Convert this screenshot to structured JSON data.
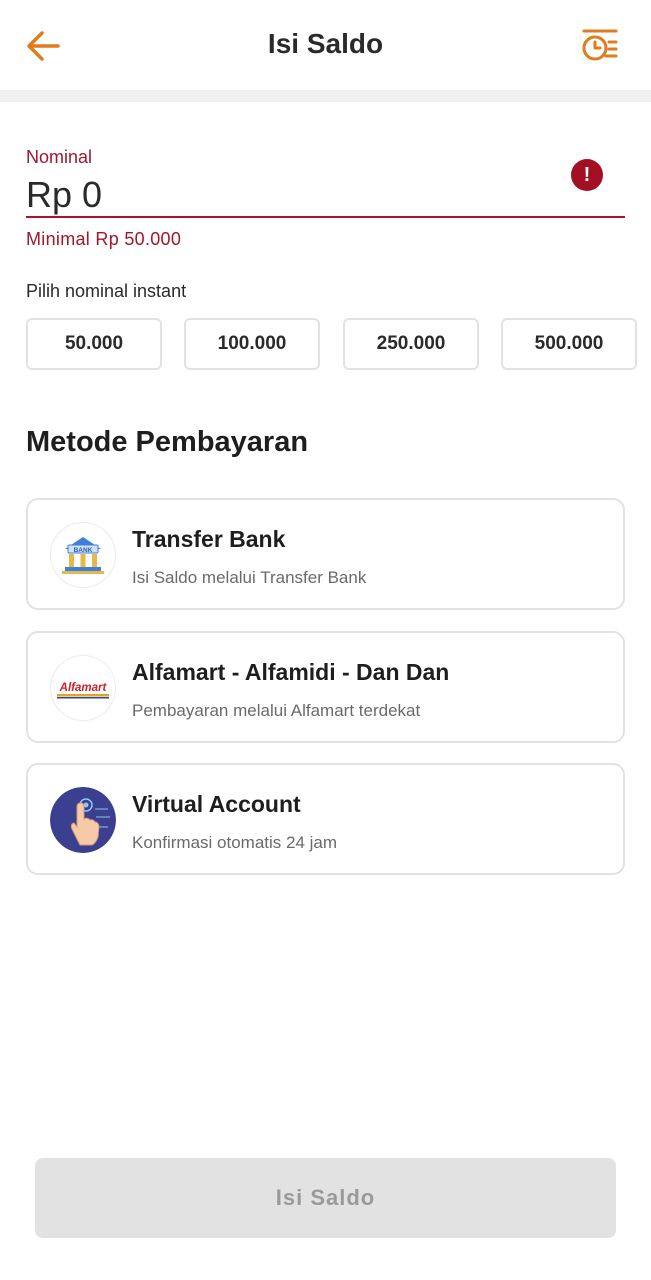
{
  "header": {
    "title": "Isi Saldo",
    "back_icon": "arrow-left-icon",
    "history_icon": "clock-list-icon",
    "accent_color": "#E07B1E"
  },
  "nominal": {
    "label": "Nominal",
    "value": "Rp 0",
    "error": "Minimal Rp 50.000",
    "error_color": "#A3162B",
    "error_icon": "exclamation-icon"
  },
  "instant": {
    "label": "Pilih nominal instant",
    "options": [
      "50.000",
      "100.000",
      "250.000",
      "500.000"
    ]
  },
  "payment": {
    "title": "Metode Pembayaran",
    "methods": [
      {
        "title": "Transfer Bank",
        "description": "Isi Saldo melalui Transfer Bank",
        "icon": "bank-icon",
        "icon_text": "BANK"
      },
      {
        "title": "Alfamart - Alfamidi - Dan Dan",
        "description": "Pembayaran melalui Alfamart terdekat",
        "icon": "alfamart-logo",
        "icon_text": "Alfamart"
      },
      {
        "title": "Virtual Account",
        "description": "Konfirmasi otomatis 24 jam",
        "icon": "virtual-account-icon"
      }
    ]
  },
  "submit": {
    "label": "Isi Saldo",
    "disabled": true
  }
}
